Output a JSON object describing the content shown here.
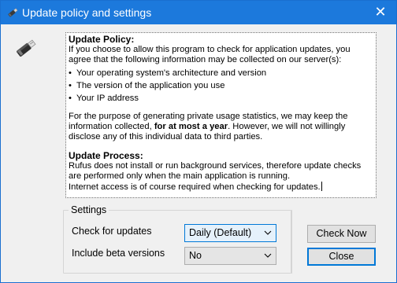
{
  "window": {
    "title": "Update policy and settings",
    "close_glyph": "✕",
    "accent": "#1c79dc"
  },
  "icons": {
    "title": "usb-drive-icon",
    "app": "usb-drive-icon"
  },
  "policy": {
    "update_heading": "Update Policy:",
    "intro": "If you choose to allow this program to check for application updates, you agree that the following information may be collected on our server(s):",
    "bullets": [
      "Your operating system's architecture and version",
      "The version of the application you use",
      "Your IP address"
    ],
    "stats_before": "For the purpose of generating private usage statistics, we may keep the information collected, ",
    "stats_bold": "for at most a year",
    "stats_after": ". However, we will not willingly disclose any of this individual data to third parties.",
    "process_heading": "Update Process:",
    "process_text": "Rufus does not install or run background services, therefore update checks are performed only when the main application is running.",
    "internet_text": "Internet access is of course required when checking for updates."
  },
  "settings": {
    "legend": "Settings",
    "check_label": "Check for updates",
    "check_value": "Daily (Default)",
    "beta_label": "Include beta versions",
    "beta_value": "No"
  },
  "buttons": {
    "check_now": "Check Now",
    "close": "Close"
  }
}
